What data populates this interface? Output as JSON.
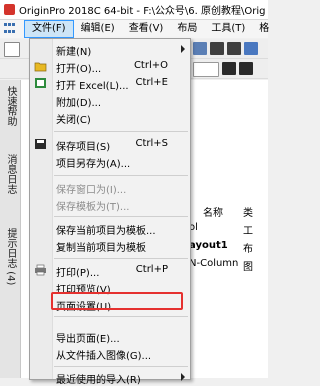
{
  "window": {
    "title": "OriginPro 2018C 64-bit - F:\\公众号\\6. 原创教程\\Orig"
  },
  "menubar": {
    "items": [
      {
        "label": "文件(F)",
        "active": true
      },
      {
        "label": "编辑(E)"
      },
      {
        "label": "查看(V)"
      },
      {
        "label": "布局"
      },
      {
        "label": "工具(T)"
      },
      {
        "label": "格"
      }
    ]
  },
  "side_tabs": [
    "快速帮助",
    "消息日志",
    "提示日志 (4)"
  ],
  "workspace": {
    "col_headers": [
      "名称",
      "类"
    ],
    "rows": [
      "ol",
      "ayout1",
      "N-Column"
    ],
    "row_types": [
      "工",
      "布",
      "图"
    ]
  },
  "file_menu": {
    "items": [
      {
        "label": "新建(N)",
        "shortcut": "",
        "submenu": true,
        "icon": "",
        "disabled": false
      },
      {
        "label": "打开(O)...",
        "shortcut": "Ctrl+O",
        "icon": "open-folder-icon",
        "disabled": false
      },
      {
        "label": "打开 Excel(L)...",
        "shortcut": "Ctrl+E",
        "icon": "excel-icon",
        "disabled": false
      },
      {
        "label": "附加(D)...",
        "shortcut": "",
        "icon": "",
        "disabled": false
      },
      {
        "label": "关闭(C)",
        "shortcut": "",
        "icon": "",
        "disabled": false
      },
      {
        "label": "保存项目(S)",
        "shortcut": "Ctrl+S",
        "icon": "save-icon",
        "disabled": false
      },
      {
        "label": "项目另存为(A)...",
        "shortcut": "",
        "icon": "",
        "disabled": false
      },
      {
        "label": "保存窗口为(I)...",
        "shortcut": "",
        "icon": "",
        "disabled": true
      },
      {
        "label": "保存模板为(T)...",
        "shortcut": "",
        "icon": "",
        "disabled": true
      },
      {
        "label": "保存当前项目为模板...",
        "shortcut": "",
        "icon": "",
        "disabled": false
      },
      {
        "label": "复制当前项目为模板",
        "shortcut": "",
        "icon": "",
        "disabled": false
      },
      {
        "label": "打印(P)...",
        "shortcut": "Ctrl+P",
        "icon": "printer-icon",
        "disabled": false
      },
      {
        "label": "打印预览(V)",
        "shortcut": "",
        "icon": "",
        "disabled": false
      },
      {
        "label": "页面设置(U)...",
        "shortcut": "",
        "icon": "",
        "disabled": false
      },
      {
        "label": "导出页面(E)...",
        "shortcut": "",
        "icon": "",
        "disabled": false
      },
      {
        "label": "从文件插入图像(G)...",
        "shortcut": "",
        "icon": "",
        "disabled": false
      },
      {
        "label": "最近使用的导入(R)",
        "shortcut": "",
        "submenu": true,
        "icon": "",
        "disabled": false
      }
    ]
  },
  "colors": {
    "highlight": "#e5312f",
    "menu_hover": "#cde5f7",
    "accent": "#3399ff"
  }
}
